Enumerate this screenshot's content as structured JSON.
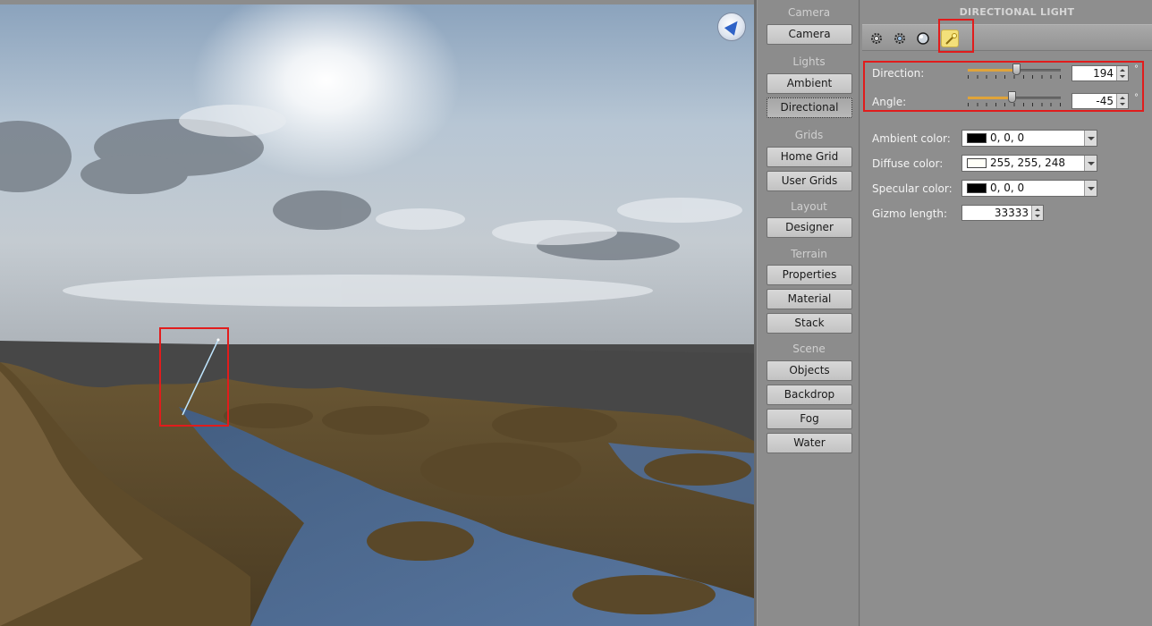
{
  "nav": {
    "sections": [
      {
        "title": "Camera",
        "buttons": [
          "Camera"
        ]
      },
      {
        "title": "Lights",
        "buttons": [
          "Ambient",
          "Directional"
        ]
      },
      {
        "title": "Grids",
        "buttons": [
          "Home Grid",
          "User Grids"
        ]
      },
      {
        "title": "Layout",
        "buttons": [
          "Designer"
        ]
      },
      {
        "title": "Terrain",
        "buttons": [
          "Properties",
          "Material",
          "Stack"
        ]
      },
      {
        "title": "Scene",
        "buttons": [
          "Objects",
          "Backdrop",
          "Fog",
          "Water"
        ]
      }
    ],
    "active": "Directional"
  },
  "panel": {
    "title": "DIRECTIONAL LIGHT",
    "toolbar_icons": [
      "gear-sun-icon",
      "gear-alt-icon",
      "sphere-icon",
      "light-wand-icon"
    ],
    "active_tool": "light-wand-icon",
    "direction": {
      "label": "Direction:",
      "value": "194",
      "unit": "°",
      "slider_fraction": 0.52
    },
    "angle": {
      "label": "Angle:",
      "value": "-45",
      "unit": "°",
      "slider_fraction": 0.48
    },
    "ambient_color": {
      "label": "Ambient color:",
      "value": "0, 0, 0",
      "swatch": "#000000"
    },
    "diffuse_color": {
      "label": "Diffuse color:",
      "value": "255, 255, 248",
      "swatch": "#fffff8"
    },
    "specular_color": {
      "label": "Specular color:",
      "value": "0, 0, 0",
      "swatch": "#000000"
    },
    "gizmo_length": {
      "label": "Gizmo length:",
      "value": "33333"
    }
  },
  "colors": {
    "highlight": "#e11c1c",
    "slider_fill": "#e0a43a",
    "active_tool_bg": "#f3e07a"
  }
}
